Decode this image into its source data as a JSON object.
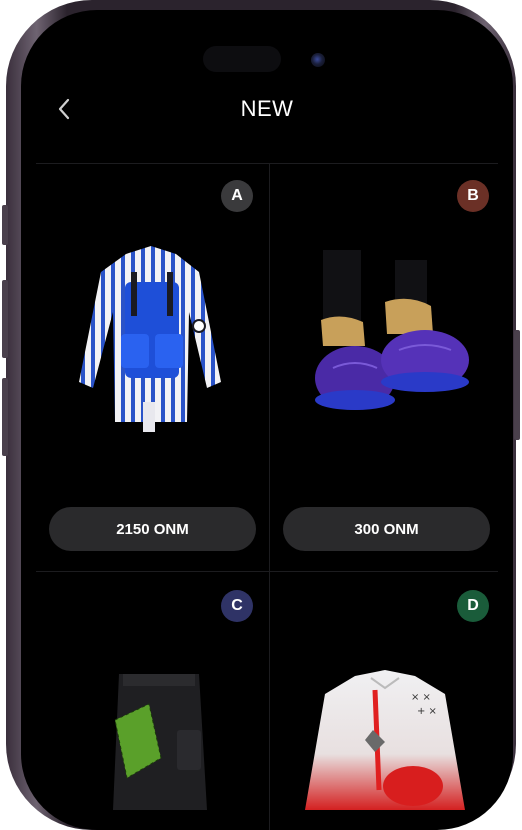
{
  "header": {
    "title": "NEW",
    "back_icon": "chevron-left-icon"
  },
  "items": [
    {
      "badge": "A",
      "badge_color": "#3a3a3c",
      "price": "2150 ONM",
      "image": "striped-jacket-with-blue-vest"
    },
    {
      "badge": "B",
      "badge_color": "#6b3026",
      "price": "300 ONM",
      "image": "purple-puffer-boots"
    },
    {
      "badge": "C",
      "badge_color": "#2f3366",
      "image": "black-cargo-pants-with-green-checkered-scarf"
    },
    {
      "badge": "D",
      "badge_color": "#1a5c3a",
      "image": "white-red-jacket-with-crossbody-bag"
    }
  ]
}
